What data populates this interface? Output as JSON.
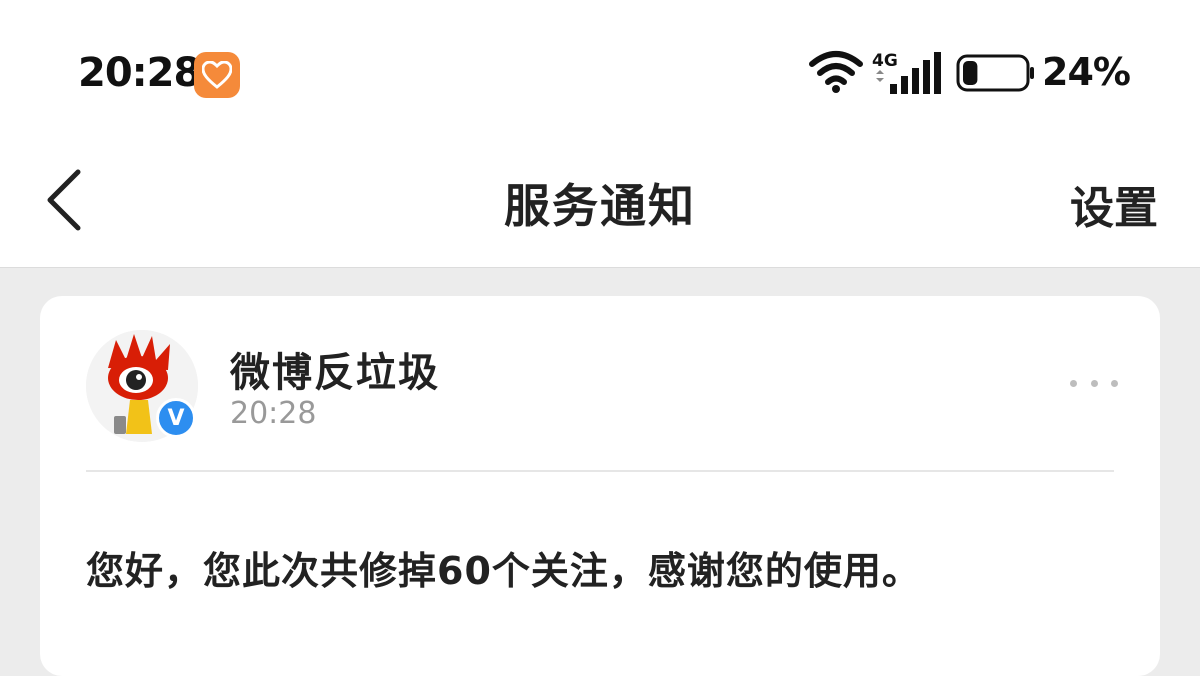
{
  "status_bar": {
    "time": "20:28",
    "battery_percent": "24%",
    "network_label": "4G",
    "battery_level": 0.24,
    "app_badge_icon": "heart-app-icon",
    "app_badge_color": "#f58a3a"
  },
  "nav": {
    "title": "服务通知",
    "settings_label": "设置",
    "back_icon": "back-chevron-icon"
  },
  "notification": {
    "sender_name": "微博反垃圾",
    "time": "20:28",
    "verified_mark": "V",
    "message": "您好，您此次共修掉60个关注，感谢您的使用。",
    "more_icon": "more-dots-icon",
    "verified_color": "#2d8ef0"
  }
}
